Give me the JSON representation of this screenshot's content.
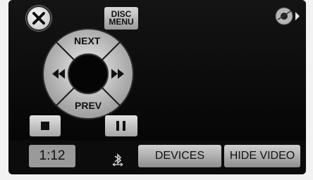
{
  "disc_menu": {
    "line1": "DISC",
    "line2": "MENU"
  },
  "pad": {
    "next_label": "NEXT",
    "prev_label": "PREV"
  },
  "playback": {
    "elapsed_time": "1:12"
  },
  "bottom_bar": {
    "devices_label": "DEVICES",
    "hide_video_label": "HIDE VIDEO"
  },
  "icons": {
    "close": "close-icon",
    "corner": "disc-arrow-icon",
    "rewind": "rewind-icon",
    "fast_forward": "fast-forward-icon",
    "stop": "stop-icon",
    "pause": "pause-icon",
    "bluetooth": "bluetooth-icon"
  }
}
